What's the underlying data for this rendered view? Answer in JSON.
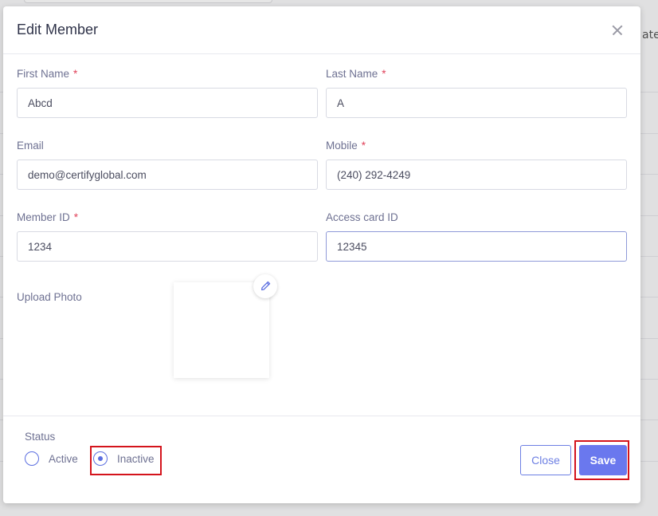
{
  "background": {
    "right_header_fragment": "ate"
  },
  "modal": {
    "title": "Edit Member",
    "required_marker": "*",
    "fields": {
      "first_name": {
        "label": "First Name",
        "value": "Abcd",
        "required": true
      },
      "last_name": {
        "label": "Last Name",
        "value": "A",
        "required": true
      },
      "email": {
        "label": "Email",
        "value": "demo@certifyglobal.com",
        "required": false
      },
      "mobile": {
        "label": "Mobile",
        "value": "(240) 292-4249",
        "required": true
      },
      "member_id": {
        "label": "Member ID",
        "value": "1234",
        "required": true
      },
      "access_card_id": {
        "label": "Access card ID",
        "value": "12345",
        "required": false
      }
    },
    "upload_photo_label": "Upload Photo",
    "status": {
      "label": "Status",
      "options": [
        {
          "label": "Active",
          "checked": false
        },
        {
          "label": "Inactive",
          "checked": true
        }
      ]
    },
    "buttons": {
      "close": "Close",
      "save": "Save"
    }
  },
  "colors": {
    "accent": "#6a78ee",
    "required": "#e0425a",
    "highlight_box": "#d4141c"
  },
  "icons": {
    "close": "close-icon",
    "edit_photo": "pencil-icon"
  }
}
